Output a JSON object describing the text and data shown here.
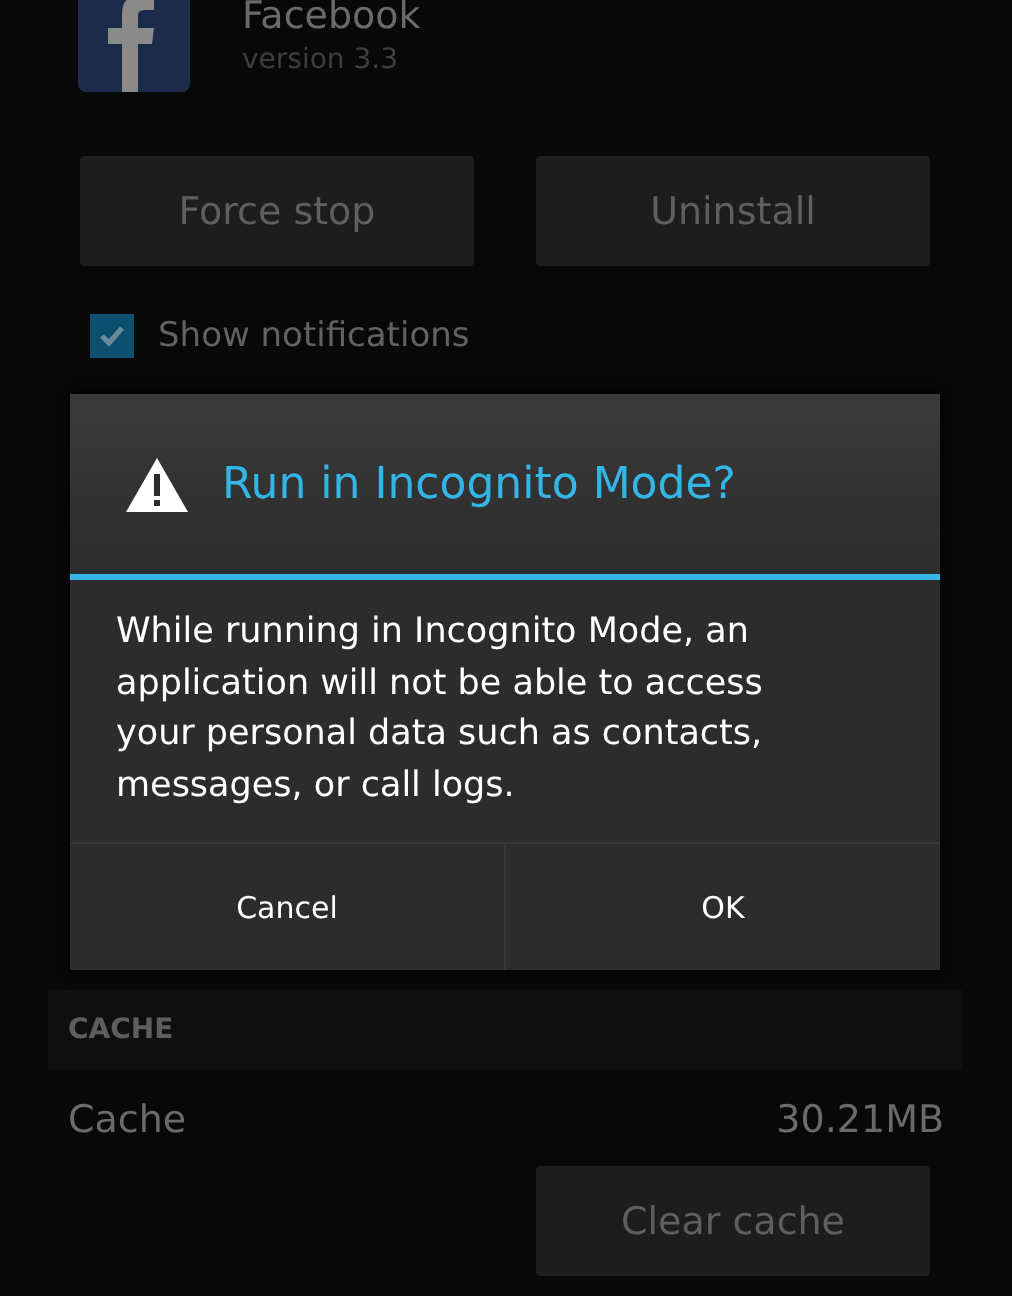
{
  "app": {
    "name": "Facebook",
    "version": "version 3.3"
  },
  "actions": [
    "Force stop",
    "Uninstall"
  ],
  "notifications": {
    "label": "Show notifications",
    "checked": true
  },
  "dialog": {
    "title": "Run in Incognito Mode?",
    "message": "While running in Incognito Mode, an application will not be able to access your personal data such as contacts, messages, or call logs.",
    "buttons": [
      "Cancel",
      "OK"
    ]
  },
  "cache": {
    "header": "CACHE",
    "label": "Cache",
    "value": "30.21MB",
    "button": "Clear cache"
  }
}
